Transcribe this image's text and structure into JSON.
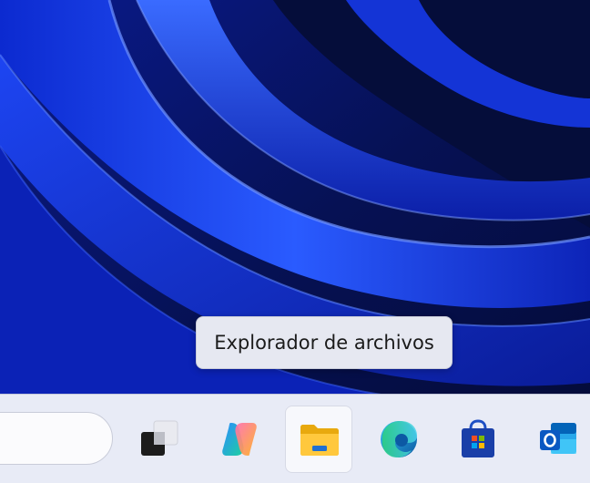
{
  "tooltip": {
    "text": "Explorador de archivos"
  },
  "taskbar": {
    "apps": [
      {
        "name": "Vista de tareas",
        "icon": "task-view-icon"
      },
      {
        "name": "Copilot",
        "icon": "copilot-icon"
      },
      {
        "name": "Explorador de archivos",
        "icon": "file-explorer-icon",
        "active": true
      },
      {
        "name": "Microsoft Edge",
        "icon": "edge-icon"
      },
      {
        "name": "Microsoft Store",
        "icon": "store-icon"
      },
      {
        "name": "Outlook",
        "icon": "outlook-icon"
      }
    ]
  },
  "colors": {
    "taskbar_bg": "#e8ebf6",
    "tooltip_bg": "#e6e8f1",
    "wallpaper_base": "#06103f",
    "wallpaper_accent": "#1d4dff"
  }
}
